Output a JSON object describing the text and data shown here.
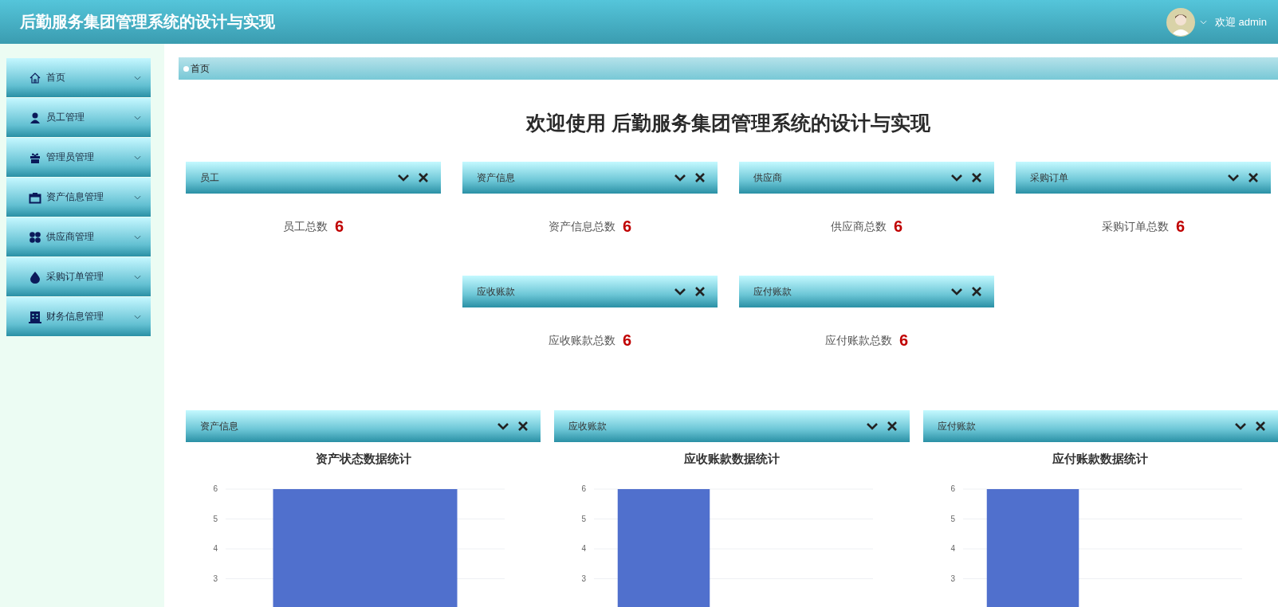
{
  "header": {
    "title": "后勤服务集团管理系统的设计与实现",
    "user": "欢迎 admin"
  },
  "sidebar": {
    "items": [
      {
        "label": "首页"
      },
      {
        "label": "员工管理"
      },
      {
        "label": "管理员管理"
      },
      {
        "label": "资产信息管理"
      },
      {
        "label": "供应商管理"
      },
      {
        "label": "采购订单管理"
      },
      {
        "label": "财务信息管理"
      }
    ]
  },
  "breadcrumb": "首页",
  "welcome": "欢迎使用 后勤服务集团管理系统的设计与实现",
  "stat_rows": [
    {
      "cards": [
        {
          "title": "员工",
          "label": "员工总数",
          "count": "6"
        },
        {
          "title": "资产信息",
          "label": "资产信息总数",
          "count": "6"
        },
        {
          "title": "供应商",
          "label": "供应商总数",
          "count": "6"
        },
        {
          "title": "采购订单",
          "label": "采购订单总数",
          "count": "6"
        }
      ]
    },
    {
      "cards": [
        {
          "title": "应收账款",
          "label": "应收账款总数",
          "count": "6"
        },
        {
          "title": "应付账款",
          "label": "应付账款总数",
          "count": "6"
        }
      ]
    }
  ],
  "chart_cards": [
    {
      "title": "资产信息",
      "chart_data": {
        "type": "bar",
        "title": "资产状态数据统计",
        "values": [
          6
        ],
        "ylim": [
          0,
          6
        ],
        "yticks": [
          3,
          4,
          5,
          6
        ],
        "grid": true
      }
    },
    {
      "title": "应收账款",
      "chart_data": {
        "type": "bar",
        "title": "应收账款数据统计",
        "values": [
          6,
          null
        ],
        "ylim": [
          0,
          6
        ],
        "yticks": [
          3,
          4,
          5,
          6
        ],
        "grid": true
      }
    },
    {
      "title": "应付账款",
      "chart_data": {
        "type": "bar",
        "title": "应付账款数据统计",
        "values": [
          6,
          null
        ],
        "ylim": [
          0,
          6
        ],
        "yticks": [
          3,
          4,
          5,
          6
        ],
        "grid": true
      }
    }
  ]
}
